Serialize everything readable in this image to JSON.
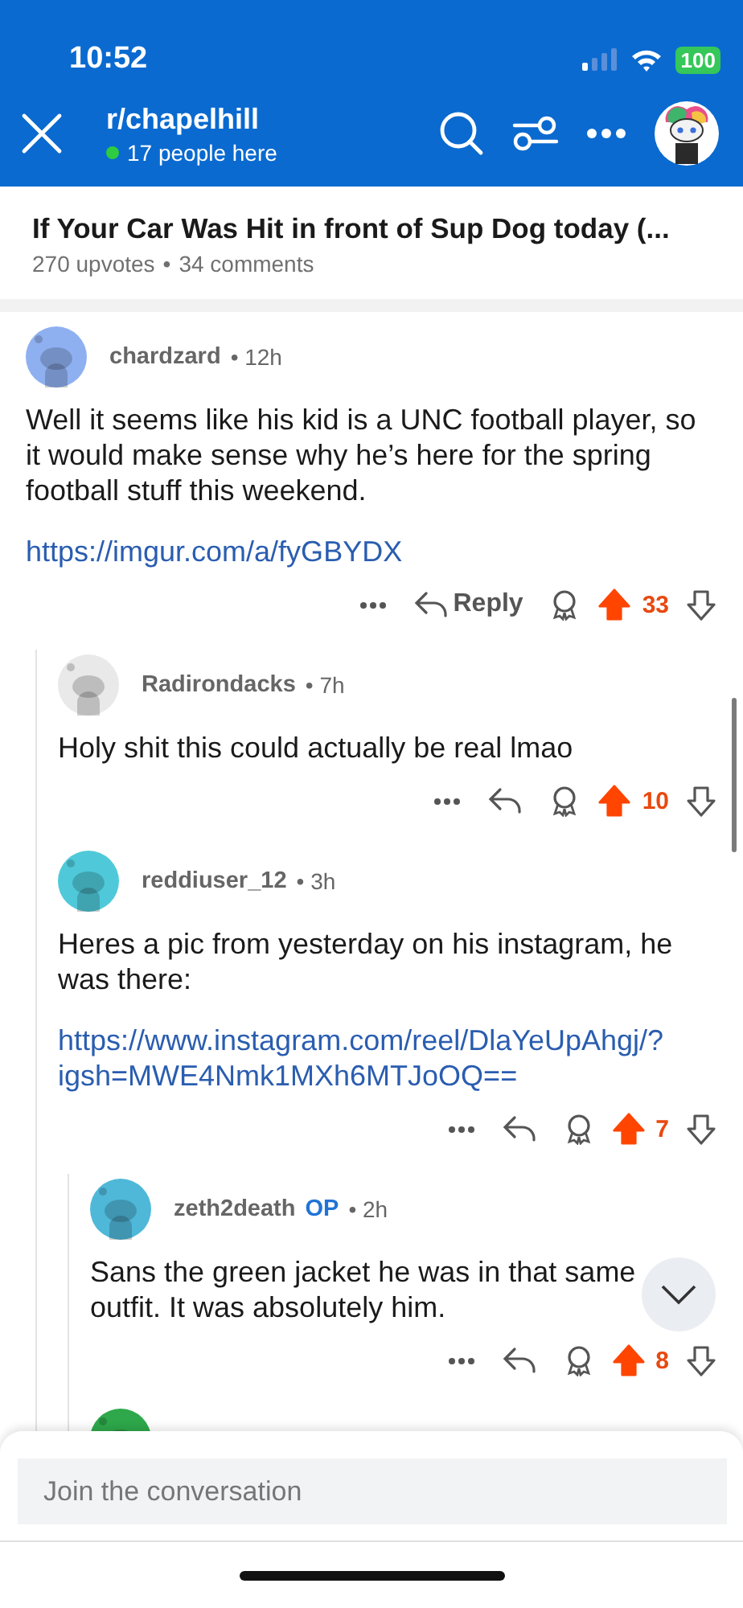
{
  "status_bar": {
    "time": "10:52",
    "battery": "100"
  },
  "header": {
    "subreddit": "r/chapelhill",
    "online": "17 people here"
  },
  "post": {
    "title": "If Your Car Was Hit in front of Sup Dog today (...",
    "upvotes": "270 upvotes",
    "comments": "34 comments",
    "separator": "•"
  },
  "comments": [
    {
      "author": "chardzard",
      "time": "• 12h",
      "color": "#8fb0f0",
      "body": "Well it seems like his kid is a UNC football player, so it would make sense why he’s here for the spring football stuff this weekend.",
      "link": "https://imgur.com/a/fyGBYDX",
      "reply_label": "Reply",
      "score": "33",
      "upvoted": true,
      "children": [
        {
          "author": "Radirondacks",
          "time": "• 7h",
          "color": "#e9e9ea",
          "body": "Holy shit this could actually be real lmao",
          "score": "10",
          "upvoted": true
        },
        {
          "author": "reddiuser_12",
          "time": "• 3h",
          "color": "#4fc9d9",
          "body": "Heres a pic from yesterday on his instagram, he was there:",
          "link": "https://www.instagram.com/reel/DlaYeUpAhgj/?igsh=MWE4Nmk1MXh6MTJoOQ==",
          "score": "7",
          "upvoted": true,
          "children": [
            {
              "author": "zeth2death",
              "op": "OP",
              "time": "• 2h",
              "color": "#4fb8d9",
              "body": "Sans the green jacket he was in that same outfit. It was absolutely him.",
              "score": "8",
              "upvoted": true
            },
            {
              "color": "#2ea84a"
            }
          ]
        }
      ]
    }
  ],
  "composer": {
    "placeholder": "Join the conversation"
  }
}
